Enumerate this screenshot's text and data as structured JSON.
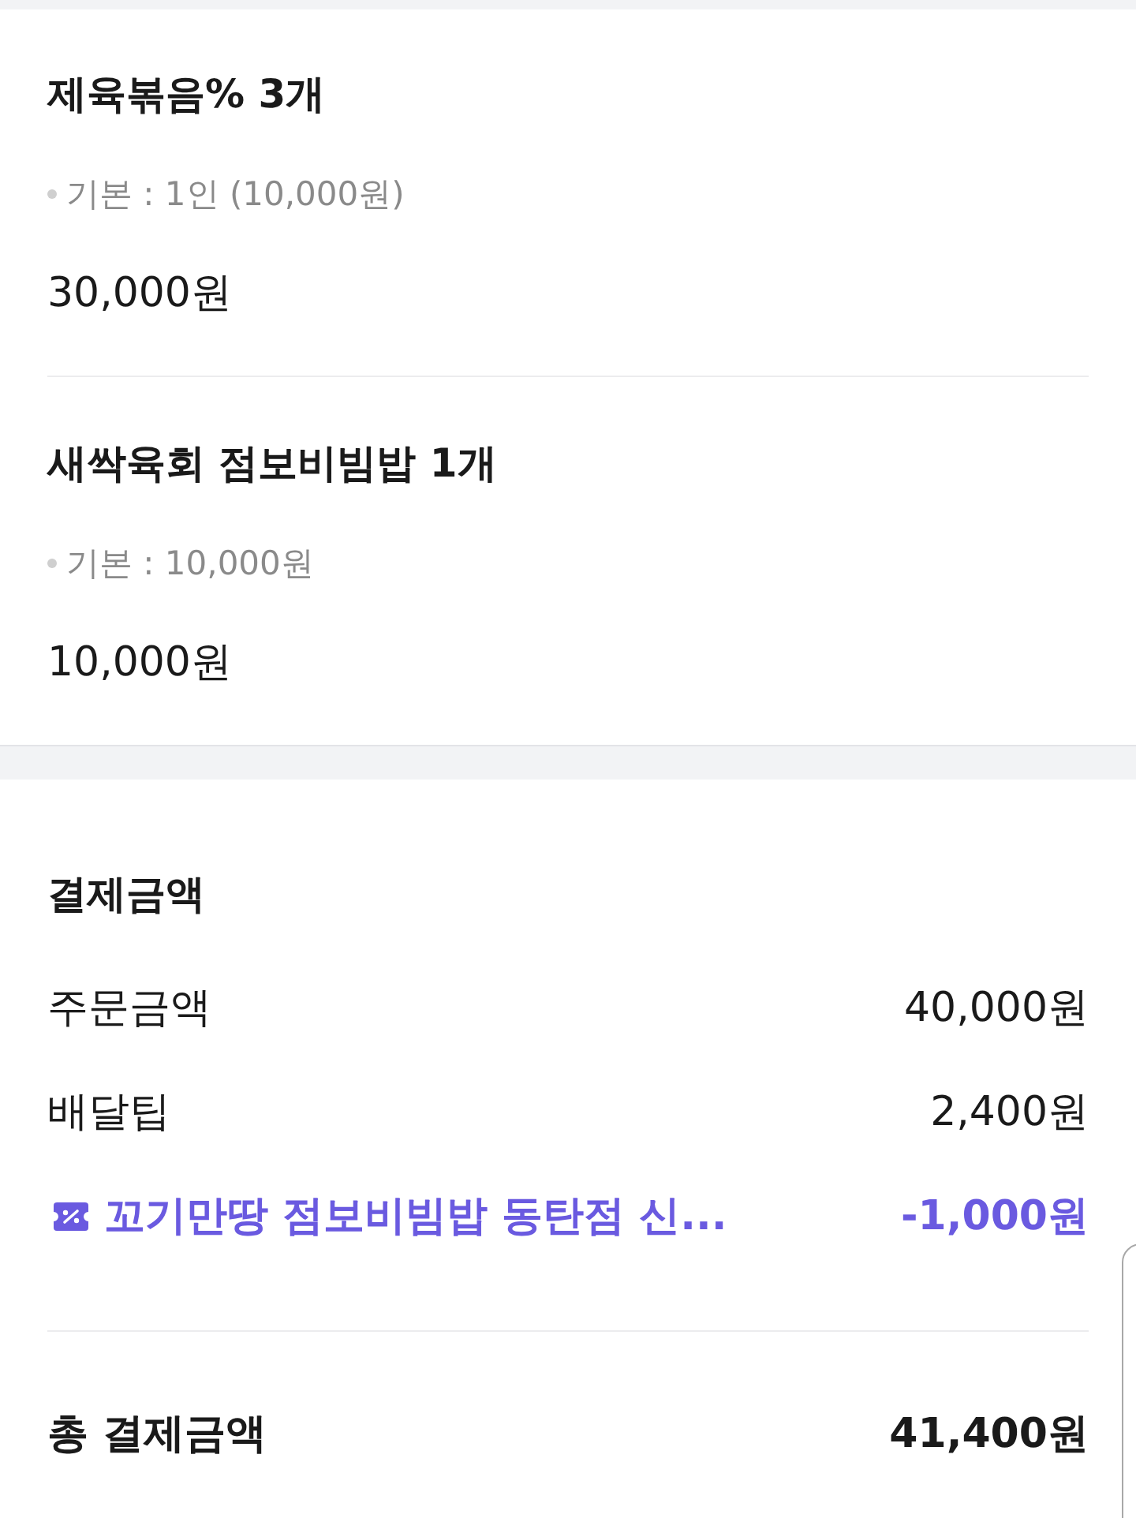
{
  "order_items": [
    {
      "name": "제육볶음% 3개",
      "option": "기본 : 1인 (10,000원)",
      "price": "30,000원"
    },
    {
      "name": "새싹육회 점보비빔밥 1개",
      "option": "기본 : 10,000원",
      "price": "10,000원"
    }
  ],
  "payment": {
    "title": "결제금액",
    "rows": [
      {
        "kind": "plain",
        "label": "주문금액",
        "amount": "40,000원"
      },
      {
        "kind": "plain",
        "label": "배달팁",
        "amount": "2,400원"
      },
      {
        "kind": "coupon",
        "label": "꼬기만땅 점보비빔밥 동탄점 신...",
        "amount": "-1,000원"
      }
    ],
    "total": {
      "label": "총 결제금액",
      "amount": "41,400원"
    }
  }
}
